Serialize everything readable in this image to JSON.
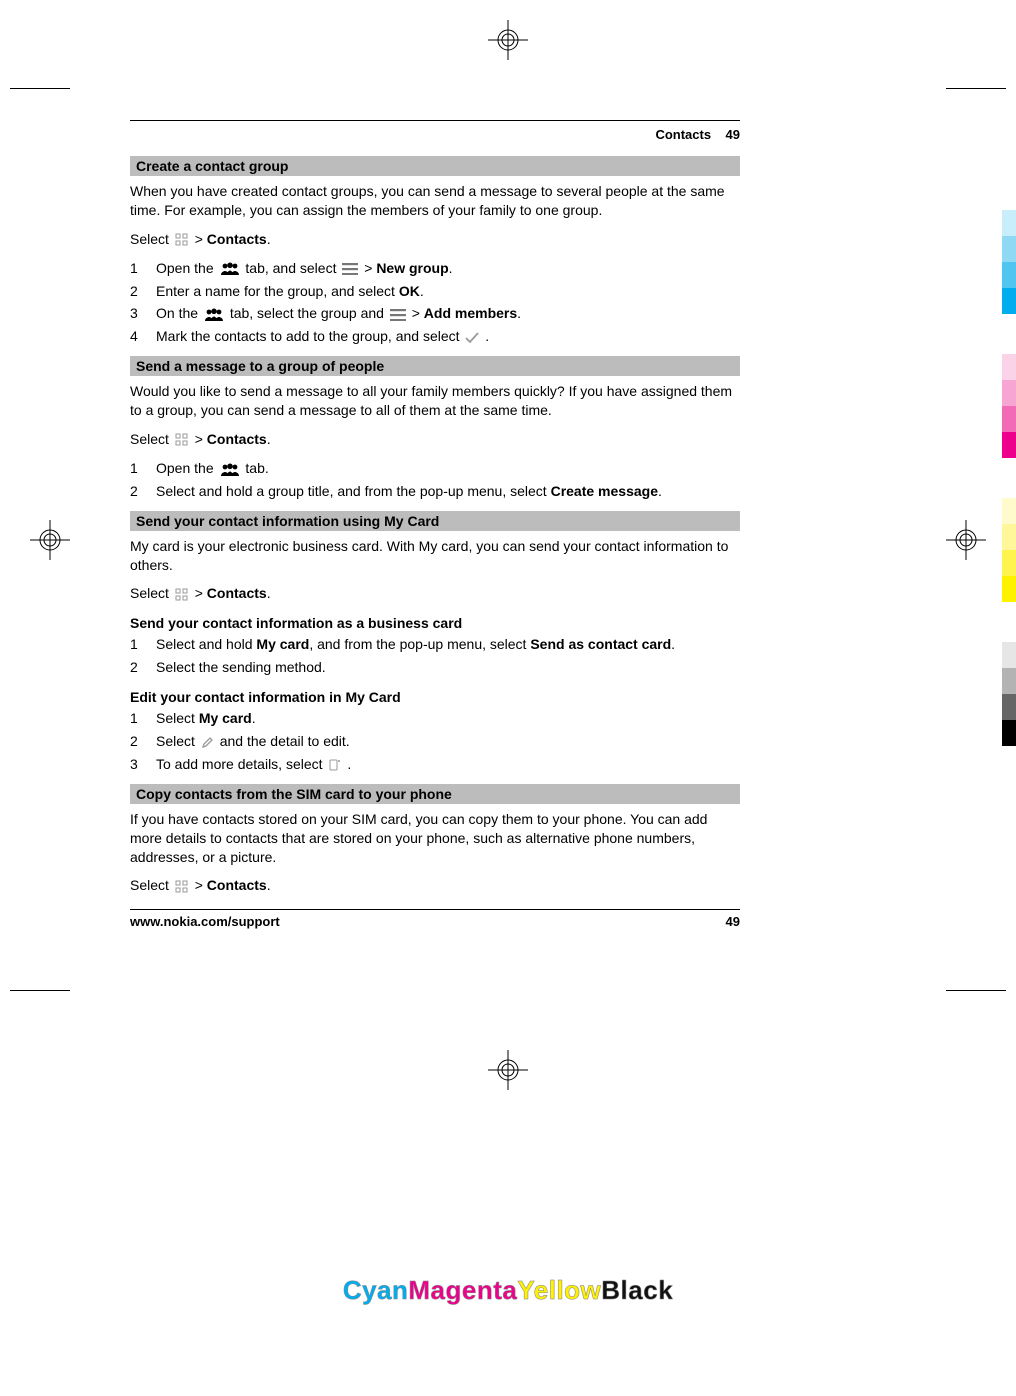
{
  "header": {
    "section": "Contacts",
    "page": "49"
  },
  "s1": {
    "title": "Create a contact group",
    "intro": "When you have created contact groups, you can send a message to several people at the same time. For example, you can assign the members of your family to one group.",
    "select_prefix": "Select ",
    "select_gt": "  > ",
    "select_target": "Contacts",
    "select_dot": ".",
    "step1a": "Open the ",
    "step1b": " tab, and select ",
    "step1gt": "  > ",
    "step1c": "New group",
    "step1dot": ".",
    "step2a": "Enter a name for the group, and select ",
    "step2b": "OK",
    "step2dot": ".",
    "step3a": "On the ",
    "step3b": " tab, select the group and ",
    "step3gt": "  > ",
    "step3c": "Add members",
    "step3dot": ".",
    "step4a": "Mark the contacts to add to the group, and select ",
    "step4dot": "."
  },
  "s2": {
    "title": "Send a message to a group of people",
    "intro": "Would you like to send a message to all your family members quickly? If you have assigned them to a group, you can send a message to all of them at the same time.",
    "select_prefix": "Select ",
    "select_gt": "  > ",
    "select_target": "Contacts",
    "select_dot": ".",
    "step1a": "Open the ",
    "step1b": " tab.",
    "step2a": "Select and hold a group title, and from the pop-up menu, select ",
    "step2b": "Create message",
    "step2dot": "."
  },
  "s3": {
    "title": "Send your contact information using My Card",
    "intro": "My card is your electronic business card. With My card, you can send your contact information to others.",
    "select_prefix": "Select ",
    "select_gt": "  > ",
    "select_target": "Contacts",
    "select_dot": ".",
    "sub1": "Send your contact information as a business card",
    "s1_step1a": "Select and hold ",
    "s1_step1b": "My card",
    "s1_step1c": ", and from the pop-up menu, select ",
    "s1_step1d": "Send as contact card",
    "s1_step1dot": ".",
    "s1_step2": "Select the sending method.",
    "sub2": "Edit your contact information in My Card",
    "s2_step1a": "Select ",
    "s2_step1b": "My card",
    "s2_step1dot": ".",
    "s2_step2a": "Select ",
    "s2_step2b": " and the detail to edit.",
    "s2_step3a": "To add more details, select ",
    "s2_step3dot": "."
  },
  "s4": {
    "title": "Copy contacts from the SIM card to your phone",
    "intro": "If you have contacts stored on your SIM card, you can copy them to your phone. You can add more details to contacts that are stored on your phone, such as alternative phone numbers, addresses, or a picture.",
    "select_prefix": "Select ",
    "select_gt": "  > ",
    "select_target": "Contacts",
    "select_dot": "."
  },
  "footer": {
    "url": "www.nokia.com/support",
    "page": "49"
  },
  "cmyk": {
    "c": "Cyan",
    "m": "Magenta",
    "y": "Yellow",
    "k": "Black"
  }
}
